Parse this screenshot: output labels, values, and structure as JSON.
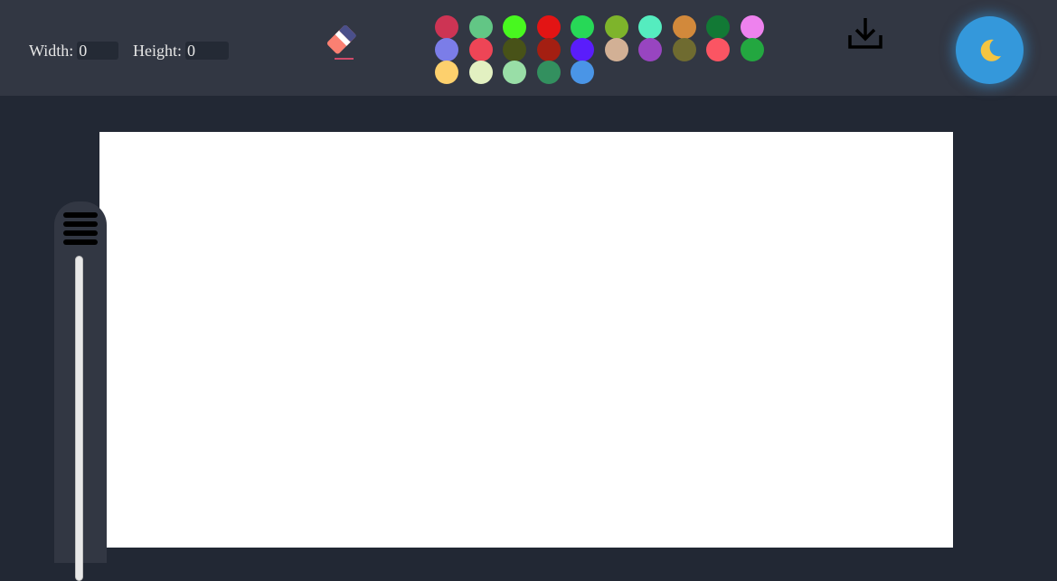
{
  "dimensions": {
    "width_label": "Width:",
    "width_value": "0",
    "height_label": "Height:",
    "height_value": "0"
  },
  "toolbar": {
    "eraser_icon": "eraser-icon",
    "download_icon": "download-icon",
    "theme_icon": "moon-icon",
    "theme_glyph": "🌙"
  },
  "palette": {
    "colors": [
      "#cd3454",
      "#62c685",
      "#48f81f",
      "#e31414",
      "#27d857",
      "#7eb42b",
      "#55ecbf",
      "#d2893b",
      "#127935",
      "#ee82ee",
      "#7b7de8",
      "#ee4556",
      "#485218",
      "#a41f12",
      "#5a1dfb",
      "#d2b095",
      "#9845c0",
      "#6f6b30",
      "#fb5563",
      "#23a740",
      "#fdd06d",
      "#e2f0c1",
      "#99dea7",
      "#33905f",
      "#4a95e6"
    ]
  },
  "colors": {
    "toolbar_bg": "#323743",
    "page_bg": "#222834",
    "canvas_bg": "#ffffff",
    "theme_button": "#3498db",
    "moon": "#f5c542"
  },
  "sidebar": {
    "menu_icon": "hamburger-menu-icon"
  }
}
